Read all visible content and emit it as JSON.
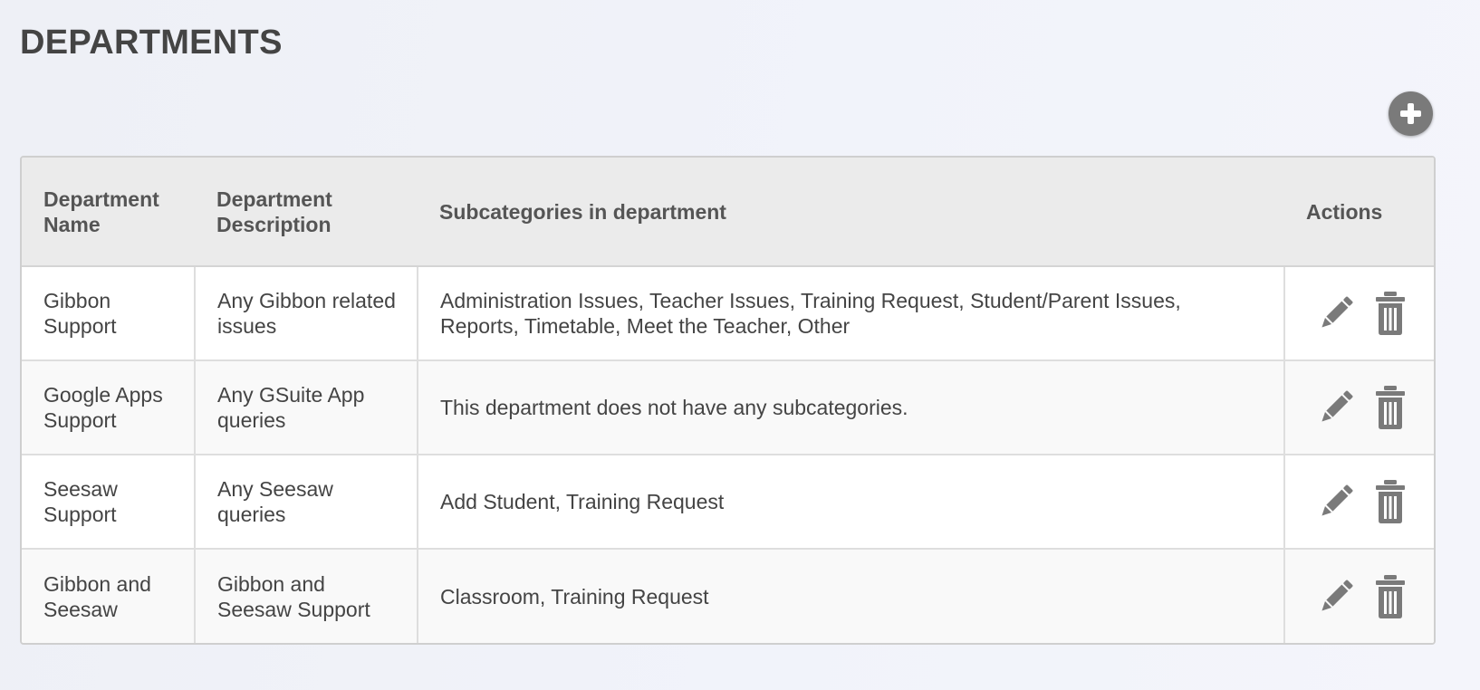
{
  "page": {
    "title": "DEPARTMENTS"
  },
  "toolbar": {
    "add_icon": "plus-circle-icon"
  },
  "table": {
    "headers": {
      "name": "Department Name",
      "description": "Department Description",
      "subcategories": "Subcategories in department",
      "actions": "Actions"
    },
    "rows": [
      {
        "name": "Gibbon Support",
        "description": "Any Gibbon related issues",
        "subcategories": "Administration Issues, Teacher Issues, Training Request, Student/Parent Issues, Reports, Timetable, Meet the Teacher, Other"
      },
      {
        "name": "Google Apps Support",
        "description": "Any GSuite App queries",
        "subcategories": "This department does not have any subcategories."
      },
      {
        "name": "Seesaw Support",
        "description": "Any Seesaw queries",
        "subcategories": "Add Student, Training Request"
      },
      {
        "name": "Gibbon and Seesaw",
        "description": "Gibbon and Seesaw Support",
        "subcategories": "Classroom, Training Request"
      }
    ],
    "action_icons": [
      "pencil-icon",
      "trash-icon"
    ]
  },
  "colors": {
    "header_bg": "#ebebeb",
    "icon_gray": "#7a7a7a",
    "text": "#444444"
  }
}
